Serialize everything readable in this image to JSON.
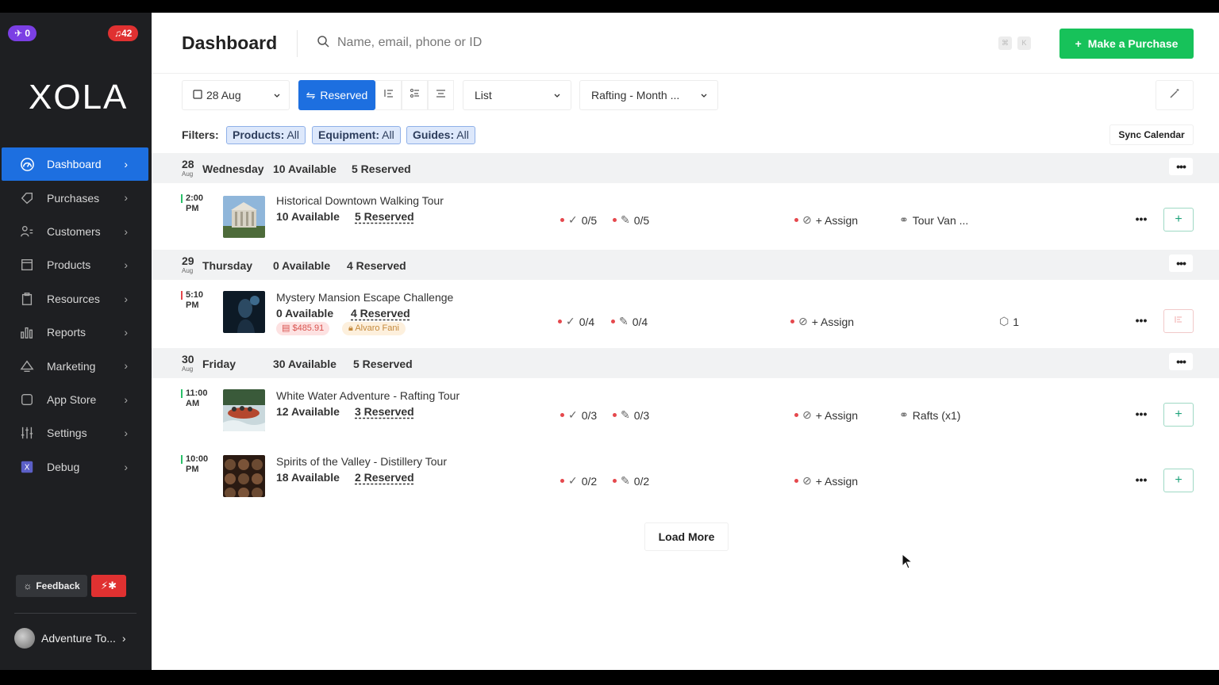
{
  "sidebar": {
    "badge_notifications": "0",
    "badge_alerts": "42",
    "logo": "XOLA",
    "items": [
      {
        "label": "Dashboard",
        "icon": "dashboard-icon"
      },
      {
        "label": "Purchases",
        "icon": "tag-icon"
      },
      {
        "label": "Customers",
        "icon": "users-icon"
      },
      {
        "label": "Products",
        "icon": "box-icon"
      },
      {
        "label": "Resources",
        "icon": "clipboard-icon"
      },
      {
        "label": "Reports",
        "icon": "bar-chart-icon"
      },
      {
        "label": "Marketing",
        "icon": "megaphone-icon"
      },
      {
        "label": "App Store",
        "icon": "square-icon"
      },
      {
        "label": "Settings",
        "icon": "sliders-icon"
      },
      {
        "label": "Debug",
        "icon": "debug-x-icon"
      }
    ],
    "feedback_label": "Feedback",
    "account_name": "Adventure To..."
  },
  "header": {
    "title": "Dashboard",
    "search_placeholder": "Name, email, phone or ID",
    "kbd_1": "⌘",
    "kbd_2": "K",
    "purchase_label": "Make a Purchase"
  },
  "toolbar": {
    "date": "28 Aug",
    "view_mode": "Reserved",
    "layout": "List",
    "product_filter": "Rafting - Month ..."
  },
  "filters": {
    "label": "Filters:",
    "chips": [
      {
        "key": "Products:",
        "value": "All"
      },
      {
        "key": "Equipment:",
        "value": "All"
      },
      {
        "key": "Guides:",
        "value": "All"
      }
    ],
    "sync_label": "Sync Calendar"
  },
  "days": [
    {
      "day_num": "28",
      "month": "Aug",
      "weekday": "Wednesday",
      "available": "10 Available",
      "reserved": "5 Reserved",
      "tours": [
        {
          "time_1": "2:00",
          "time_2": "PM",
          "status_color": "#2bbf6a",
          "name": "Historical Downtown Walking Tour",
          "available": "10 Available",
          "reserved": "5 Reserved",
          "checkin": "0/5",
          "waiver": "0/5",
          "assign": "+ Assign",
          "resource": "Tour Van ..."
        }
      ]
    },
    {
      "day_num": "29",
      "month": "Aug",
      "weekday": "Thursday",
      "available": "0 Available",
      "reserved": "4 Reserved",
      "tours": [
        {
          "time_1": "5:10",
          "time_2": "PM",
          "status_color": "#e5484d",
          "name": "Mystery Mansion Escape Challenge",
          "available": "0 Available",
          "reserved": "4 Reserved",
          "price_tag": "$485.91",
          "guide_tag": "Alvaro Fani",
          "checkin": "0/4",
          "waiver": "0/4",
          "assign": "+ Assign",
          "equipment_count": "1"
        }
      ]
    },
    {
      "day_num": "30",
      "month": "Aug",
      "weekday": "Friday",
      "available": "30 Available",
      "reserved": "5 Reserved",
      "tours": [
        {
          "time_1": "11:00",
          "time_2": "AM",
          "status_color": "#2bbf6a",
          "name": "White Water Adventure - Rafting Tour",
          "available": "12 Available",
          "reserved": "3 Reserved",
          "checkin": "0/3",
          "waiver": "0/3",
          "assign": "+ Assign",
          "resource": "Rafts (x1)"
        },
        {
          "time_1": "10:00",
          "time_2": "PM",
          "status_color": "#2bbf6a",
          "name": "Spirits of the Valley - Distillery Tour",
          "available": "18 Available",
          "reserved": "2 Reserved",
          "checkin": "0/2",
          "waiver": "0/2",
          "assign": "+ Assign"
        }
      ]
    }
  ],
  "load_more_label": "Load More",
  "colors": {
    "primary": "#1d6fe0",
    "success": "#17c25a",
    "danger": "#e03131",
    "sidebar_bg": "#1e1f22"
  }
}
